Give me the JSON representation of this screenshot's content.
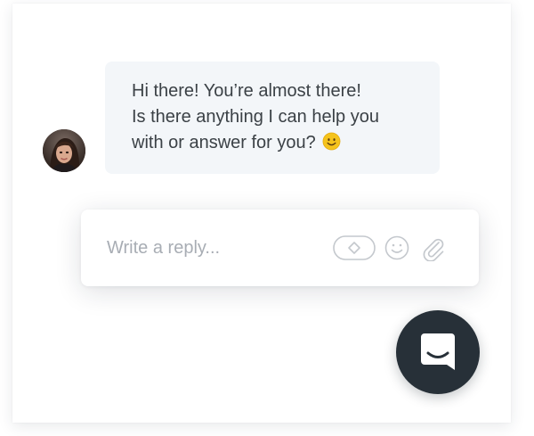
{
  "message": {
    "lines": [
      "Hi there! You’re almost there!",
      "Is there anything I can help you",
      "with or answer for you?"
    ],
    "emoji": "smiling-face-emoji"
  },
  "composer": {
    "placeholder": "Write a reply...",
    "tools": [
      "gif-icon",
      "emoji-icon",
      "paperclip-icon"
    ]
  },
  "launcher": {
    "icon": "chat-smile-icon"
  },
  "colors": {
    "bubble_bg": "#f3f6f9",
    "text": "#3b4146",
    "placeholder": "#a8adb4",
    "launcher_bg": "#273038",
    "icon_gray": "#c4c8cd",
    "emoji_yellow": "#f5c31c"
  }
}
